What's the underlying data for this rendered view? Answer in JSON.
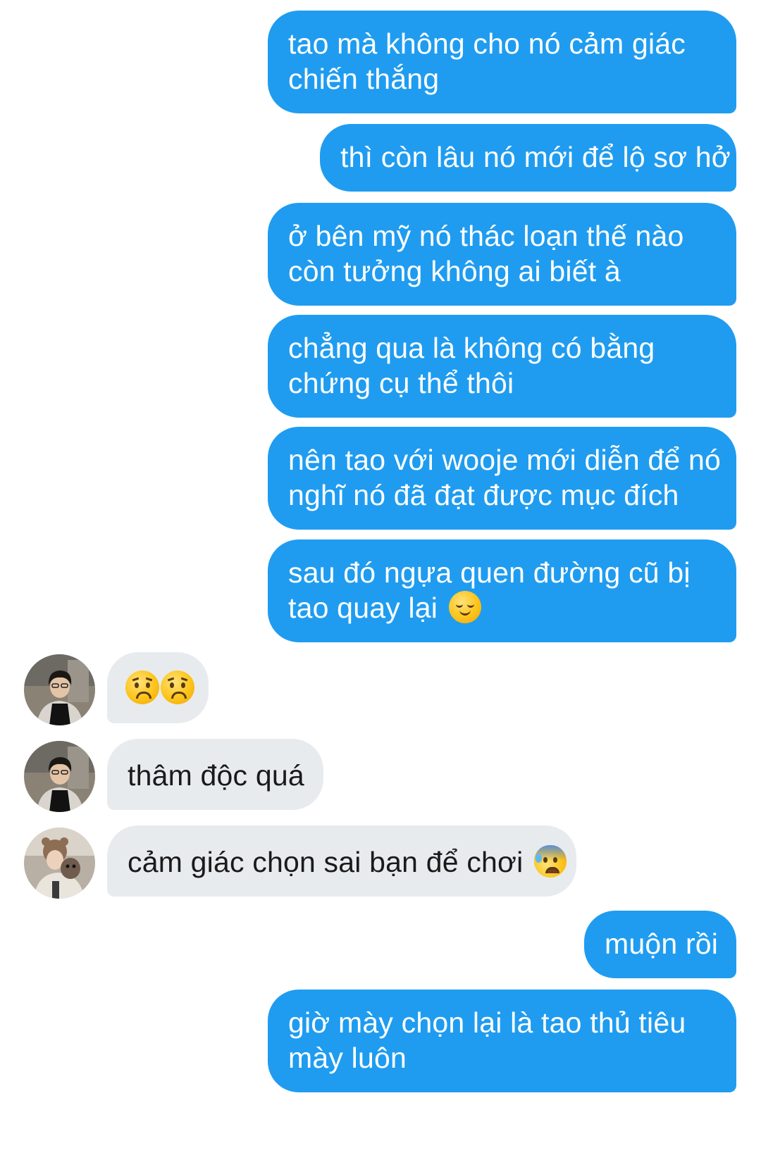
{
  "messages": {
    "m1": {
      "line1": "tao mà không cho nó cảm giác",
      "line2": "chiến thắng"
    },
    "m2": {
      "line1": "thì còn lâu nó mới để lộ sơ hở"
    },
    "m3": {
      "line1": "ở bên mỹ nó thác loạn thế nào",
      "line2": "còn tưởng không ai biết à"
    },
    "m4": {
      "line1": "chẳng qua là không có bằng",
      "line2": "chứng cụ thể thôi"
    },
    "m5": {
      "line1": "nên tao với wooje mới diễn để nó",
      "line2": "nghĩ nó đã đạt được mục đích"
    },
    "m6": {
      "line1": "sau đó ngựa quen đường cũ bị",
      "line2": "tao quay lại",
      "emoji": "relieved-face-icon"
    },
    "m7": {
      "emoji1": "worried-face-icon",
      "emoji2": "worried-face-icon"
    },
    "m8": {
      "line1": "thâm độc quá"
    },
    "m9": {
      "line1": "cảm giác chọn sai bạn để chơi",
      "emoji": "anxious-face-with-sweat-icon"
    },
    "m10": {
      "line1": "muộn rồi"
    },
    "m11": {
      "line1": "giờ mày chọn lại là tao thủ tiêu",
      "line2": "mày luôn"
    }
  },
  "colors": {
    "outgoing_bubble": "#1f9cf0",
    "incoming_bubble": "#e8ebee",
    "outgoing_text": "#ffffff",
    "incoming_text": "#1a1a1a",
    "background": "#ffffff"
  }
}
